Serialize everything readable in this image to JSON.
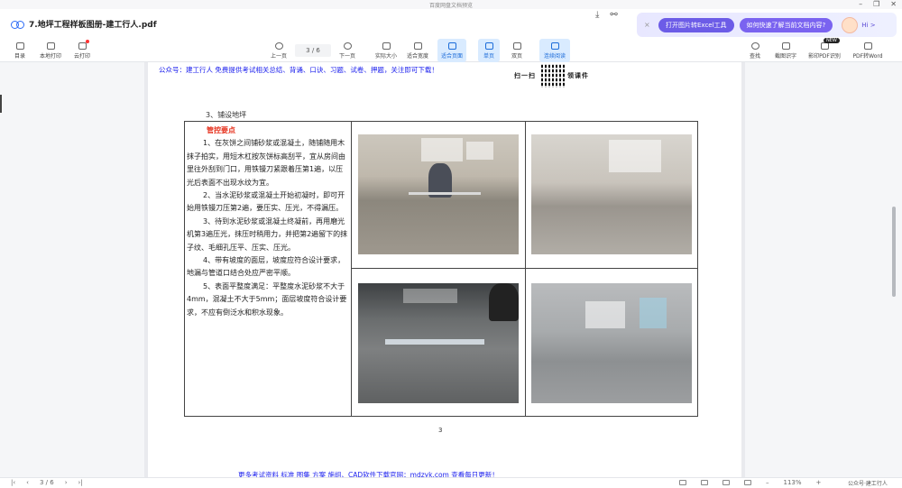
{
  "window": {
    "title": "百度网盘文档预览",
    "controls": [
      "–",
      "❐",
      "✕"
    ]
  },
  "header": {
    "file_name": "7.地坪工程样板图册-建工行人.pdf",
    "download_icon": "download-icon",
    "share_icon": "share-icon"
  },
  "ai_panel": {
    "close": "×",
    "btn_excel": "打开图片转Excel工具",
    "btn_ask": "如何快速了解当前文档内容?",
    "greeting": "Hi >"
  },
  "toolbar": {
    "left": [
      {
        "label": "目录",
        "icon": "toc-icon"
      },
      {
        "label": "本地打印",
        "icon": "print-icon"
      },
      {
        "label": "云打印",
        "icon": "cloud-print-icon"
      }
    ],
    "prev": "上一页",
    "page_indicator": "3 / 6",
    "next": "下一页",
    "center": [
      {
        "label": "实际大小",
        "icon": "actual-size-icon"
      },
      {
        "label": "适合宽度",
        "icon": "fit-width-icon"
      },
      {
        "label": "适合页面",
        "icon": "fit-page-icon",
        "active": true
      },
      {
        "label": "单页",
        "icon": "single-page-icon",
        "active": true
      },
      {
        "label": "双页",
        "icon": "double-page-icon"
      },
      {
        "label": "连续阅读",
        "icon": "continuous-read-icon",
        "active": true
      }
    ],
    "right": [
      {
        "label": "查找",
        "icon": "search-icon"
      },
      {
        "label": "截图识字",
        "icon": "screenshot-ocr-icon"
      },
      {
        "label": "影印PDF识别",
        "icon": "scan-pdf-icon"
      },
      {
        "label": "PDF转Word",
        "icon": "pdf-to-word-icon"
      }
    ],
    "new_badge": "NEW"
  },
  "document": {
    "top_notice": "公众号：建工行人 免费提供考试相关总结、背诵、口诀、习题、试卷、押题，关注即可下载！",
    "scan_text_left": "扫一扫",
    "scan_text_right": "领课件",
    "section_title": "3、铺设地坪",
    "control_points_title": "管控要点",
    "paragraphs": [
      "1、在灰饼之间铺砂浆或混凝土，随铺随用木抹子拍实，用短木杠按灰饼标高刮平，宜从房间由里往外刮到门口，用铁镘刀紧跟着压第1遍，以压光后表面不出现水纹为宜。",
      "2、当水泥砂浆或混凝土开始初凝时，即可开始用铁镘刀压第2遍，要压实、压光，不得漏压。",
      "3、待到水泥砂浆或混凝土终凝前，再用磨光机第3遍压光，抹压时稍用力，并把第2遍留下的抹子纹、毛细孔压平、压实、压光。",
      "4、带有坡度的面层，坡度应符合设计要求，地漏与管道口结合处应严密平顺。",
      "5、表面平整度满足：平整度水泥砂浆不大于4mm，混凝土不大于5mm；面层坡度符合设计要求，不应有倒泛水和积水现象。"
    ],
    "page_number": "3",
    "footer_notice": "更多考试资料 标准 图集 方案 施组、CAD软件下载官网：mdzyk.com 查看每日更新！"
  },
  "statusbar": {
    "page_indicator": "3 / 6",
    "zoom": "113%",
    "watermark": "公众号·建工行人"
  }
}
